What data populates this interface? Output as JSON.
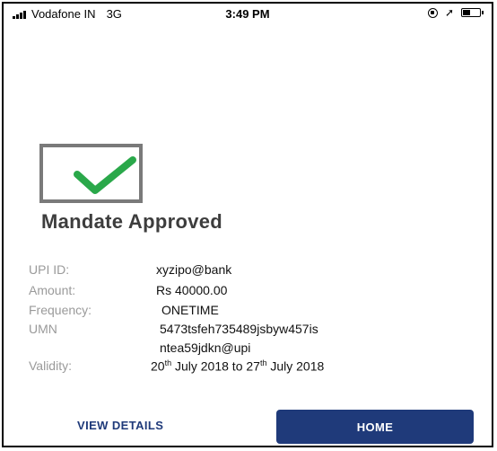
{
  "status_bar": {
    "carrier": "Vodafone IN",
    "network": "3G",
    "time": "3:49 PM",
    "battery_level": 0.45,
    "icons": [
      "signal-icon",
      "rotation-lock-icon",
      "location-arrow-icon",
      "battery-icon"
    ]
  },
  "result": {
    "title": "Mandate Approved",
    "icon": "checkbox-checked-icon",
    "check_color": "#2aa84a",
    "box_color": "#7a7a7a"
  },
  "details": {
    "upi_id_label": "UPI ID:",
    "upi_id_value": "xyzipo@bank",
    "amount_label": "Amount:",
    "amount_value": "Rs 40000.00",
    "frequency_label": "Frequency:",
    "frequency_value": "ONETIME",
    "umn_label": "UMN",
    "umn_value_line1": "5473tsfeh735489jsbyw457is",
    "umn_value_line2": "ntea59jdkn@upi",
    "validity_label": "Validity:",
    "validity_from_day": "20",
    "validity_from_suffix": "th",
    "validity_from_rest": " July 2018 to ",
    "validity_to_day": "27",
    "validity_to_suffix": "th",
    "validity_to_rest": " July 2018"
  },
  "actions": {
    "view_details_label": "VIEW DETAILS",
    "home_label": "HOME"
  },
  "colors": {
    "primary": "#1f3a7a",
    "label_gray": "#9a9a9a",
    "title_gray": "#3d3d3d"
  }
}
